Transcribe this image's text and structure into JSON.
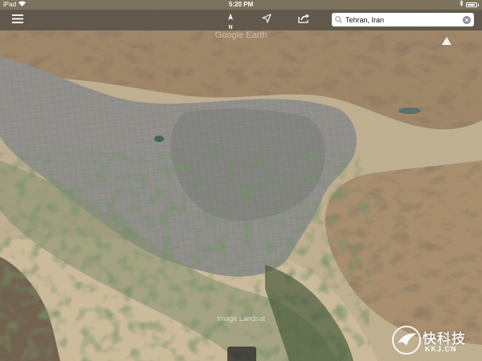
{
  "status_bar": {
    "device": "iPad",
    "time": "5:20 PM",
    "battery_level": 0.9
  },
  "toolbar": {
    "compass_letter": "N",
    "search": {
      "value": "Tehran, Iran",
      "placeholder": "Search"
    }
  },
  "map": {
    "attribution_top": "Google Earth",
    "attribution_bottom": "Image Landsat"
  },
  "watermark": {
    "brand": "快科技",
    "url": "KKJ.CN"
  },
  "colors": {
    "terrain_light": "#c9b594",
    "terrain_mountain": "#8c6f4e",
    "urban": "#8a8a86",
    "vegetation": "#3a4c2a",
    "toolbar_bg": "#141414"
  },
  "icons": [
    "wifi-icon",
    "menu-icon",
    "compass-icon",
    "location-arrow-icon",
    "share-icon",
    "search-icon",
    "clear-icon",
    "bluetooth-icon",
    "battery-icon",
    "north-arrow-icon"
  ]
}
